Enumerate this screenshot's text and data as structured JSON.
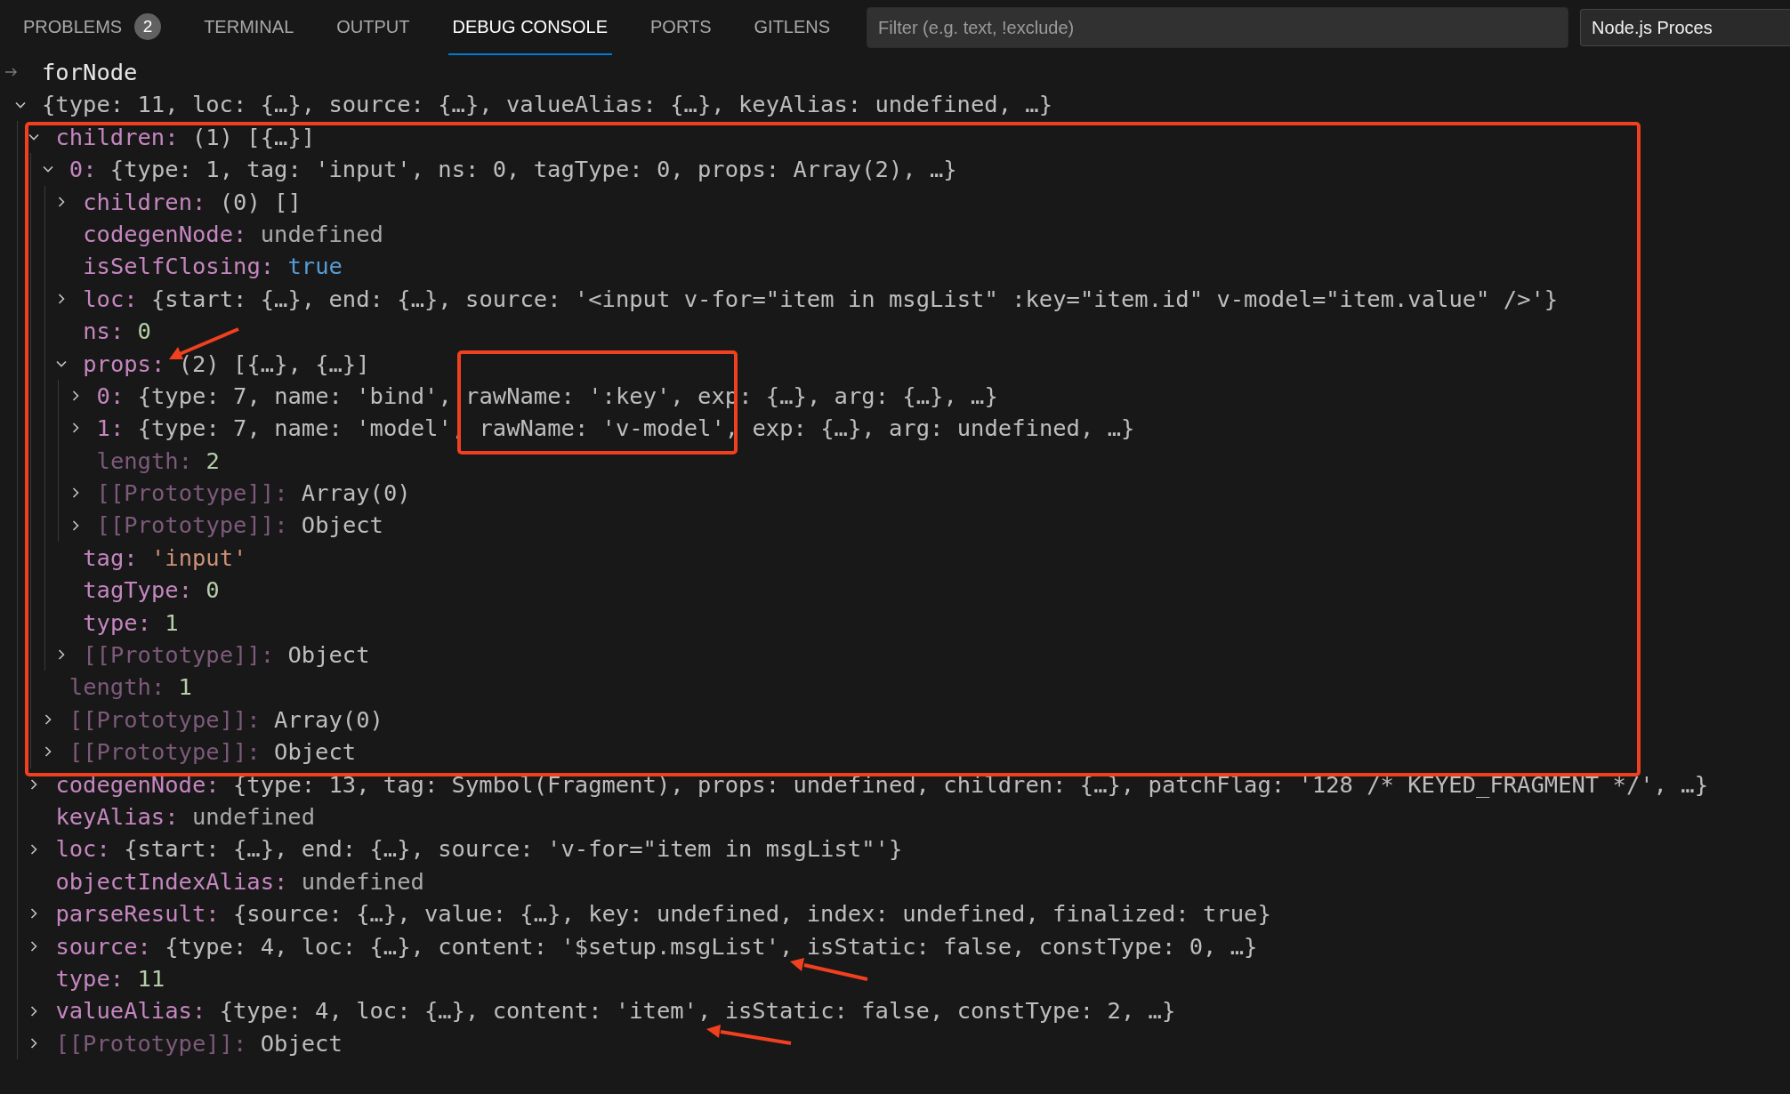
{
  "panel_tabs": [
    {
      "label": "PROBLEMS",
      "selected": false,
      "badge": "2"
    },
    {
      "label": "TERMINAL",
      "selected": false
    },
    {
      "label": "OUTPUT",
      "selected": false
    },
    {
      "label": "DEBUG CONSOLE",
      "selected": true
    },
    {
      "label": "PORTS",
      "selected": false
    },
    {
      "label": "GITLENS",
      "selected": false
    }
  ],
  "filter": {
    "placeholder": "Filter (e.g. text, !exclude)"
  },
  "session_dropdown": {
    "value": "Node.js Proces"
  },
  "console": {
    "echo": "forNode",
    "tree": [
      {
        "kind": "node",
        "expanded": true,
        "value": {
          "text": "{type: 11, loc: {…}, source: {…}, valueAlias: {…}, keyAlias: undefined, …}",
          "kind": "preview"
        },
        "children": [
          {
            "kind": "node",
            "expanded": true,
            "key": {
              "text": "children:",
              "kind": "property"
            },
            "value": {
              "text": "(1) [{…}]",
              "kind": "preview"
            },
            "children": [
              {
                "kind": "node",
                "expanded": true,
                "key": {
                  "text": "0:",
                  "kind": "property"
                },
                "value": {
                  "text": "{type: 1, tag: 'input', ns: 0, tagType: 0, props: Array(2), …}",
                  "kind": "preview"
                },
                "children": [
                  {
                    "kind": "node",
                    "expanded": false,
                    "key": {
                      "text": "children:",
                      "kind": "property"
                    },
                    "value": {
                      "text": "(0) []",
                      "kind": "preview"
                    }
                  },
                  {
                    "kind": "leaf",
                    "key": {
                      "text": "codegenNode:",
                      "kind": "property"
                    },
                    "value": {
                      "text": "undefined",
                      "kind": "undefined"
                    }
                  },
                  {
                    "kind": "leaf",
                    "key": {
                      "text": "isSelfClosing:",
                      "kind": "property"
                    },
                    "value": {
                      "text": "true",
                      "kind": "boolean"
                    }
                  },
                  {
                    "kind": "node",
                    "expanded": false,
                    "key": {
                      "text": "loc:",
                      "kind": "property"
                    },
                    "value": {
                      "text": "{start: {…}, end: {…}, source: '<input v-for=\"item in msgList\" :key=\"item.id\" v-model=\"item.value\" />'}",
                      "kind": "preview"
                    }
                  },
                  {
                    "kind": "leaf",
                    "key": {
                      "text": "ns:",
                      "kind": "property"
                    },
                    "value": {
                      "text": "0",
                      "kind": "number"
                    }
                  },
                  {
                    "kind": "node",
                    "expanded": true,
                    "key": {
                      "text": "props:",
                      "kind": "property"
                    },
                    "value": {
                      "text": "(2) [{…}, {…}]",
                      "kind": "preview"
                    },
                    "children": [
                      {
                        "kind": "node",
                        "expanded": false,
                        "key": {
                          "text": "0:",
                          "kind": "property"
                        },
                        "value": {
                          "text": "{type: 7, name: 'bind', rawName: ':key', exp: {…}, arg: {…}, …}",
                          "kind": "preview"
                        }
                      },
                      {
                        "kind": "node",
                        "expanded": false,
                        "key": {
                          "text": "1:",
                          "kind": "property"
                        },
                        "value": {
                          "text": "{type: 7, name: 'model', rawName: 'v-model', exp: {…}, arg: undefined, …}",
                          "kind": "preview"
                        }
                      },
                      {
                        "kind": "leaf",
                        "key": {
                          "text": "length:",
                          "kind": "internal"
                        },
                        "value": {
                          "text": "2",
                          "kind": "number"
                        }
                      },
                      {
                        "kind": "node",
                        "expanded": false,
                        "key": {
                          "text": "[[Prototype]]:",
                          "kind": "internal"
                        },
                        "value": {
                          "text": "Array(0)",
                          "kind": "preview"
                        }
                      },
                      {
                        "kind": "node",
                        "expanded": false,
                        "key": {
                          "text": "[[Prototype]]:",
                          "kind": "internal"
                        },
                        "value": {
                          "text": "Object",
                          "kind": "preview"
                        }
                      }
                    ]
                  },
                  {
                    "kind": "leaf",
                    "key": {
                      "text": "tag:",
                      "kind": "property"
                    },
                    "value": {
                      "text": "'input'",
                      "kind": "string"
                    }
                  },
                  {
                    "kind": "leaf",
                    "key": {
                      "text": "tagType:",
                      "kind": "property"
                    },
                    "value": {
                      "text": "0",
                      "kind": "number"
                    }
                  },
                  {
                    "kind": "leaf",
                    "key": {
                      "text": "type:",
                      "kind": "property"
                    },
                    "value": {
                      "text": "1",
                      "kind": "number"
                    }
                  },
                  {
                    "kind": "node",
                    "expanded": false,
                    "key": {
                      "text": "[[Prototype]]:",
                      "kind": "internal"
                    },
                    "value": {
                      "text": "Object",
                      "kind": "preview"
                    }
                  }
                ]
              },
              {
                "kind": "leaf",
                "key": {
                  "text": "length:",
                  "kind": "internal"
                },
                "value": {
                  "text": "1",
                  "kind": "number"
                }
              },
              {
                "kind": "node",
                "expanded": false,
                "key": {
                  "text": "[[Prototype]]:",
                  "kind": "internal"
                },
                "value": {
                  "text": "Array(0)",
                  "kind": "preview"
                }
              },
              {
                "kind": "node",
                "expanded": false,
                "key": {
                  "text": "[[Prototype]]:",
                  "kind": "internal"
                },
                "value": {
                  "text": "Object",
                  "kind": "preview"
                }
              }
            ]
          },
          {
            "kind": "node",
            "expanded": false,
            "key": {
              "text": "codegenNode:",
              "kind": "property"
            },
            "value": {
              "text": "{type: 13, tag: Symbol(Fragment), props: undefined, children: {…}, patchFlag: '128 /* KEYED_FRAGMENT */', …}",
              "kind": "preview"
            }
          },
          {
            "kind": "leaf",
            "key": {
              "text": "keyAlias:",
              "kind": "property"
            },
            "value": {
              "text": "undefined",
              "kind": "undefined"
            }
          },
          {
            "kind": "node",
            "expanded": false,
            "key": {
              "text": "loc:",
              "kind": "property"
            },
            "value": {
              "text": "{start: {…}, end: {…}, source: 'v-for=\"item in msgList\"'}",
              "kind": "preview"
            }
          },
          {
            "kind": "leaf",
            "key": {
              "text": "objectIndexAlias:",
              "kind": "property"
            },
            "value": {
              "text": "undefined",
              "kind": "undefined"
            }
          },
          {
            "kind": "node",
            "expanded": false,
            "key": {
              "text": "parseResult:",
              "kind": "property"
            },
            "value": {
              "text": "{source: {…}, value: {…}, key: undefined, index: undefined, finalized: true}",
              "kind": "preview"
            }
          },
          {
            "kind": "node",
            "expanded": false,
            "key": {
              "text": "source:",
              "kind": "property"
            },
            "value": {
              "text": "{type: 4, loc: {…}, content: '$setup.msgList', isStatic: false, constType: 0, …}",
              "kind": "preview"
            }
          },
          {
            "kind": "leaf",
            "key": {
              "text": "type:",
              "kind": "property"
            },
            "value": {
              "text": "11",
              "kind": "number"
            }
          },
          {
            "kind": "node",
            "expanded": false,
            "key": {
              "text": "valueAlias:",
              "kind": "property"
            },
            "value": {
              "text": "{type: 4, loc: {…}, content: 'item', isStatic: false, constType: 2, …}",
              "kind": "preview"
            }
          },
          {
            "kind": "node",
            "expanded": false,
            "key": {
              "text": "[[Prototype]]:",
              "kind": "internal"
            },
            "value": {
              "text": "Object",
              "kind": "preview"
            }
          }
        ]
      }
    ]
  }
}
